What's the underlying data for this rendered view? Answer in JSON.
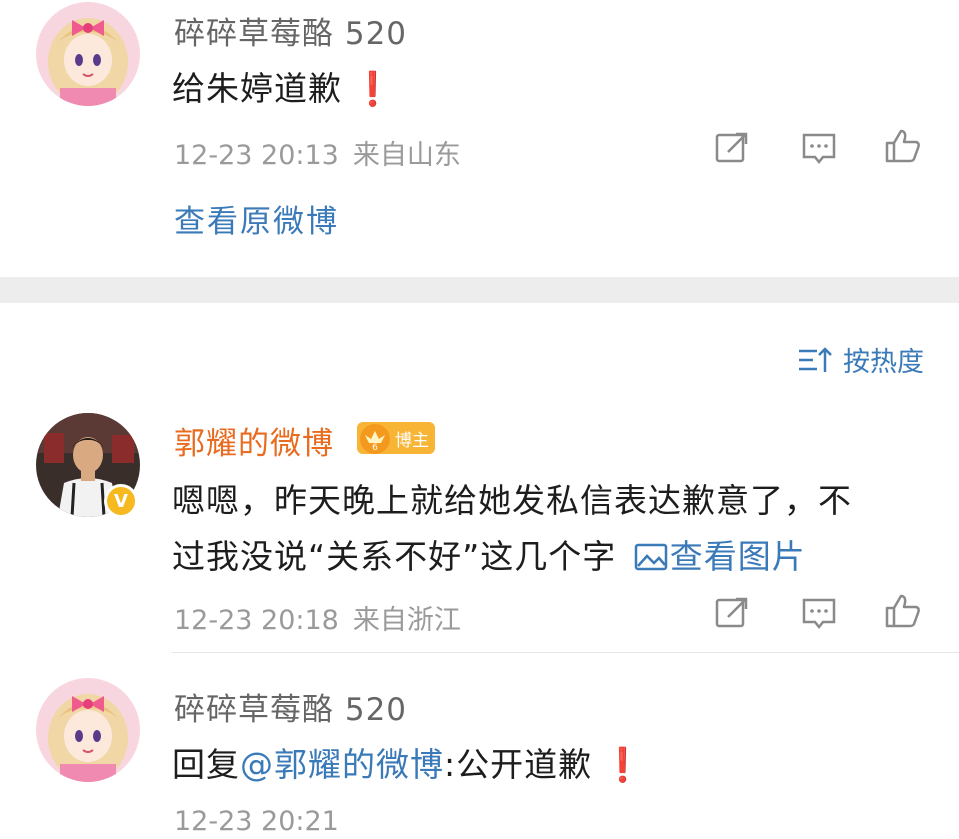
{
  "comments": [
    {
      "username": "碎碎草莓酪 520",
      "content": "给朱婷道歉",
      "time": "12-23 20:13",
      "location": "来自山东",
      "link": "查看原微博"
    },
    {
      "username": "郭耀的微博",
      "badge_label": "博主",
      "verified_mark": "V",
      "content_line1": "嗯嗯，昨天晚上就给她发私信表达歉意了，不",
      "content_line2": "过我没说“关系不好”这几个字",
      "view_image": "查看图片",
      "time": "12-23 20:18",
      "location": "来自浙江"
    },
    {
      "username": "碎碎草莓酪 520",
      "reply_prefix": "回复",
      "mention": "@郭耀的微博",
      "reply_text": ":公开道歉",
      "time": "12-23 20:21"
    }
  ],
  "sort": {
    "label": "按热度",
    "icon": "sort-icon"
  },
  "exclamation": "❗",
  "colors": {
    "link_blue": "#3b7ab8",
    "vip_orange": "#e86b1f",
    "meta_gray": "#9a9a9a",
    "exclamation_red": "#e0202a",
    "badge_gold": "#f8b535"
  }
}
